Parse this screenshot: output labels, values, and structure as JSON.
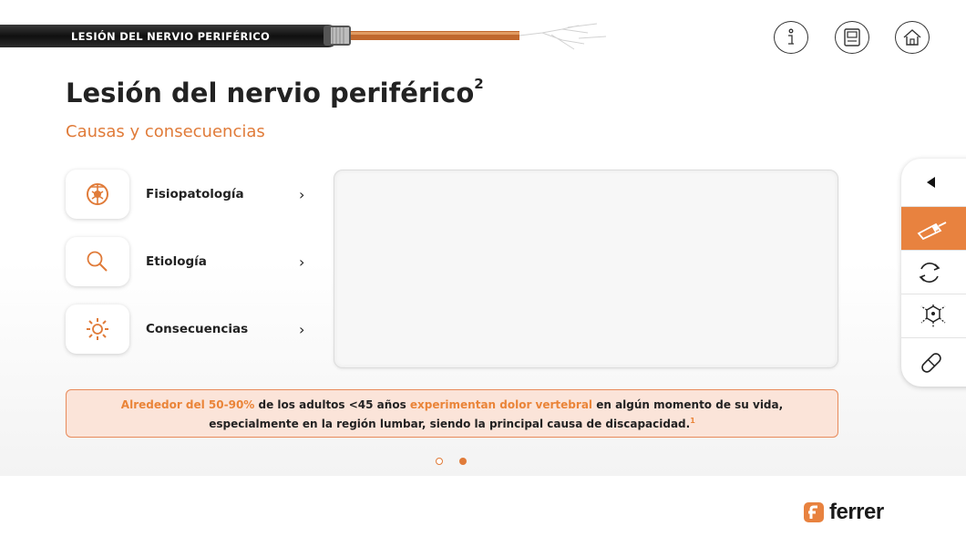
{
  "header": {
    "cable_title": "LESIÓN DEL NERVIO PERIFÉRICO",
    "buttons": [
      {
        "name": "info",
        "icon": "info-icon"
      },
      {
        "name": "book",
        "icon": "book-icon"
      },
      {
        "name": "home",
        "icon": "home-icon"
      }
    ]
  },
  "page": {
    "title": "Lesión del nervio periférico",
    "title_sup": "2",
    "subtitle": "Causas y consecuencias"
  },
  "menu": [
    {
      "label": "Fisiopatología",
      "icon": "anatomy-icon",
      "arrow": "›"
    },
    {
      "label": "Etiología",
      "icon": "magnifier-icon",
      "arrow": "›"
    },
    {
      "label": "Consecuencias",
      "icon": "radiating-circle-icon",
      "arrow": "›"
    }
  ],
  "note": {
    "part1": "Alrededor del 50-90%",
    "part2": " de los adultos <45 años ",
    "part3": "experimentan dolor vertebral",
    "part4": " en algún momento de su vida,",
    "part5": "especialmente en la región lumbar, siendo la principal causa de discapacidad.",
    "ref": "1"
  },
  "pagination": {
    "total": 2,
    "current": 2
  },
  "side_toolbar": {
    "items": [
      "collapse-arrow-icon",
      "syringe-icon",
      "cycle-icon",
      "molecule-icon",
      "pill-icon"
    ],
    "active": "syringe-icon"
  },
  "brand": {
    "name": "ferrer"
  },
  "colors": {
    "accent": "#e8823f",
    "note_bg": "#fbe4d9",
    "cable": "#1a1a1a"
  }
}
